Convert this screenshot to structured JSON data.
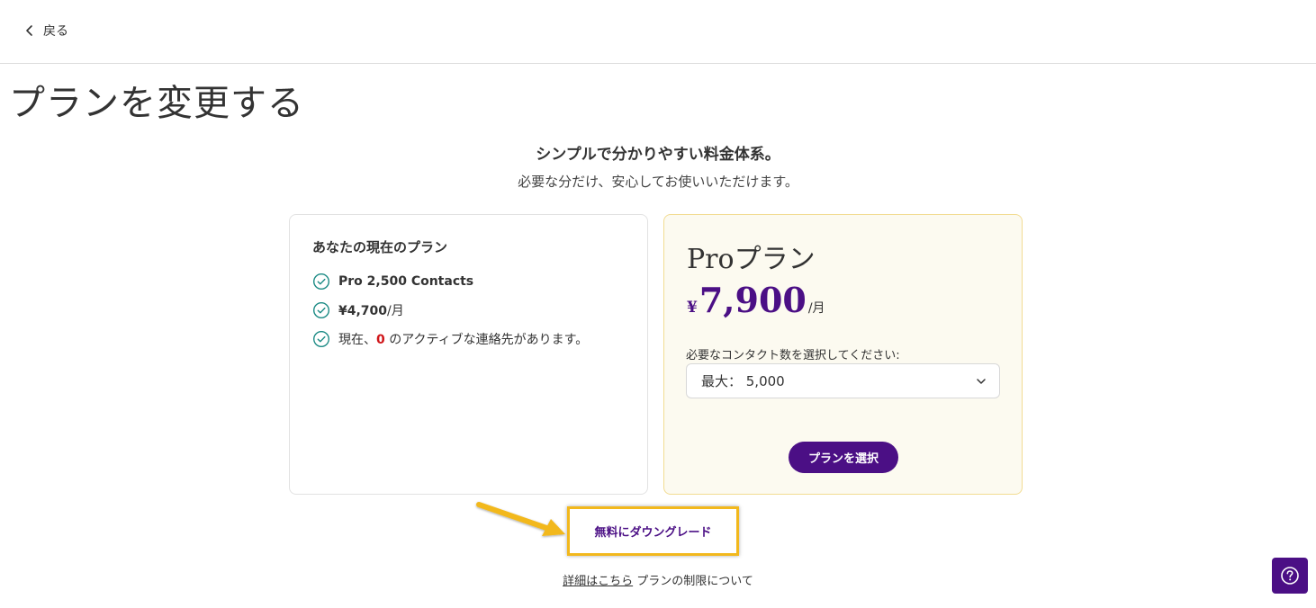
{
  "header": {
    "back_label": "戻る"
  },
  "page": {
    "title": "プランを変更する",
    "headline": "シンプルで分かりやすい料金体系。",
    "subline": "必要な分だけ、安心してお使いいただけます。"
  },
  "current_plan": {
    "title": "あなたの現在のプラン",
    "plan_name": "Pro 2,500 Contacts",
    "price": "¥4,700",
    "price_unit": "/月",
    "contacts_prefix": "現在、",
    "contacts_count": "0",
    "contacts_suffix": " のアクティブな連絡先があります。"
  },
  "pro_plan": {
    "name": "Proプラン",
    "currency": "¥",
    "price": "7,900",
    "price_unit": "/月",
    "select_label": "必要なコンタクト数を選択してください:",
    "select_value": "最大： 5,000",
    "select_button": "プランを選択"
  },
  "downgrade": {
    "label": "無料にダウングレード"
  },
  "footer": {
    "link_label": "詳細はこちら",
    "text": " プランの制限について"
  },
  "colors": {
    "brand": "#4b0f85",
    "highlight": "#f2b81c",
    "check": "#1a8a84",
    "alert": "#d0161a"
  },
  "icons": {
    "back": "chevron-left-icon",
    "check": "check-circle-icon",
    "dropdown": "chevron-down-icon",
    "help": "question-circle-icon",
    "annotation": "arrow-icon"
  }
}
